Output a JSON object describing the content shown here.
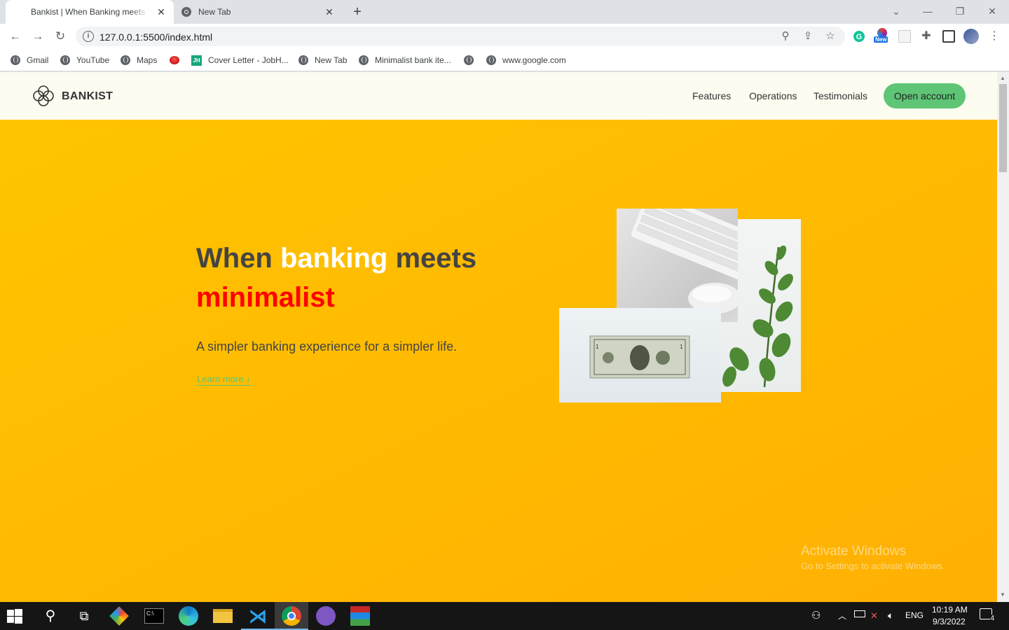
{
  "browser": {
    "tabs": [
      {
        "title": "Bankist | When Banking meets Minimalist",
        "active": true
      },
      {
        "title": "New Tab",
        "active": false
      }
    ],
    "address": "127.0.0.1:5500/index.html",
    "bookmarks": [
      {
        "label": "Gmail",
        "icon": "globe-icon"
      },
      {
        "label": "YouTube",
        "icon": "globe-icon"
      },
      {
        "label": "Maps",
        "icon": "globe-icon"
      },
      {
        "label": "",
        "icon": "red-dot-icon"
      },
      {
        "label": "Cover Letter - JobH...",
        "icon": "jh-icon"
      },
      {
        "label": "New Tab",
        "icon": "globe-icon"
      },
      {
        "label": "Minimalist bank ite...",
        "icon": "globe-icon"
      },
      {
        "label": "",
        "icon": "globe-icon"
      },
      {
        "label": "www.google.com",
        "icon": "globe-icon"
      }
    ],
    "extension_badge": "New"
  },
  "site": {
    "logo_text": "BANKIST",
    "nav": [
      "Features",
      "Operations",
      "Testimonials"
    ],
    "cta": "Open account",
    "hero": {
      "title_part1": "When ",
      "title_highlight": "banking",
      "title_part2": " meets",
      "title_line2": "minimalist",
      "subtitle": "A simpler banking experience for a simpler life.",
      "learn_more": "Learn more ↓"
    },
    "colors": {
      "accent": "#5ec576",
      "hero_bg": "#ffc400",
      "header_bg": "#fdfcf0",
      "title_red": "#ff0000"
    }
  },
  "watermark": {
    "line1": "Activate Windows",
    "line2": "Go to Settings to activate Windows."
  },
  "taskbar": {
    "language": "ENG",
    "time": "10:19 AM",
    "date": "9/3/2022",
    "notification_count": "4"
  }
}
